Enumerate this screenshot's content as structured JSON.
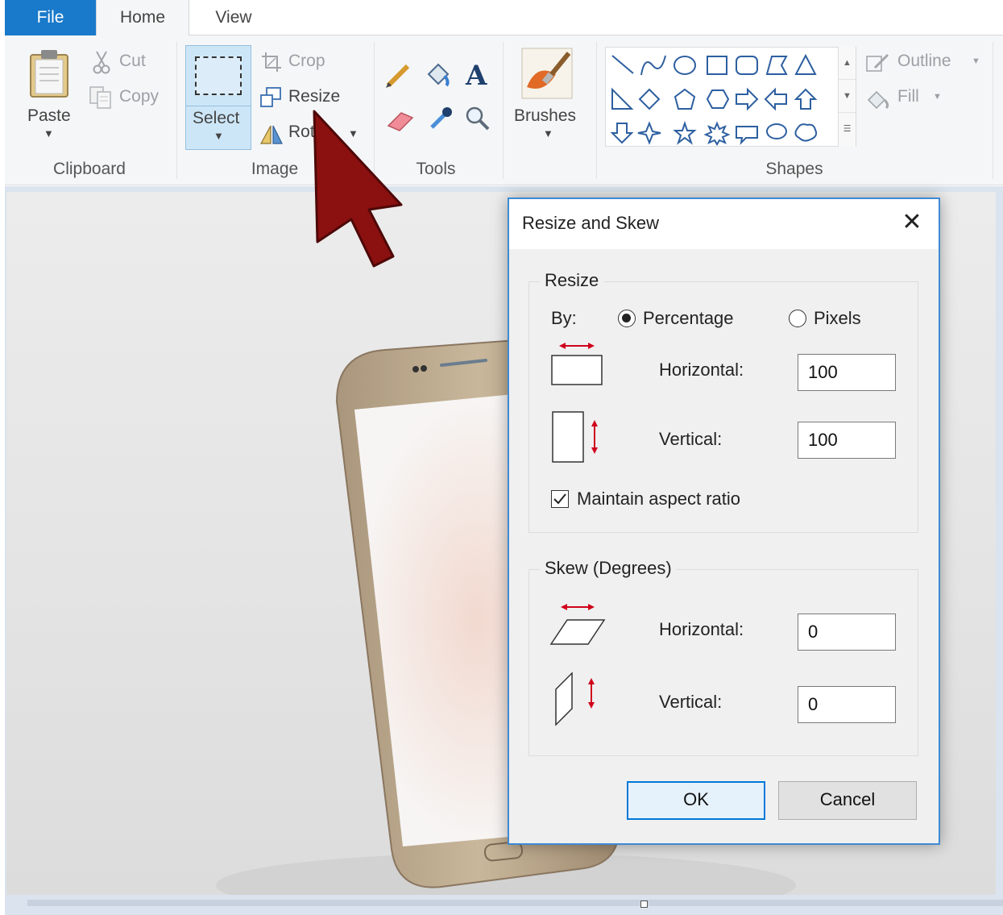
{
  "tabs": {
    "file": "File",
    "home": "Home",
    "view": "View"
  },
  "ribbon": {
    "clipboard": {
      "paste": "Paste",
      "cut": "Cut",
      "copy": "Copy",
      "label": "Clipboard"
    },
    "image": {
      "select": "Select",
      "crop": "Crop",
      "resize": "Resize",
      "rotate": "Rot",
      "label": "Image"
    },
    "tools": {
      "label": "Tools"
    },
    "brushes": {
      "label": "Brushes"
    },
    "shapes": {
      "outline": "Outline",
      "fill": "Fill",
      "label": "Shapes"
    }
  },
  "annotation": {
    "arrow_color": "#8b1010"
  },
  "dialog": {
    "title": "Resize and Skew",
    "close_glyph": "✕",
    "resize": {
      "legend": "Resize",
      "by_label": "By:",
      "percentage_label": "Percentage",
      "pixels_label": "Pixels",
      "selected_unit": "Percentage",
      "horizontal_label": "Horizontal:",
      "horizontal_value": "100",
      "vertical_label": "Vertical:",
      "vertical_value": "100",
      "maintain_label": "Maintain aspect ratio",
      "maintain_checked": true
    },
    "skew": {
      "legend": "Skew (Degrees)",
      "horizontal_label": "Horizontal:",
      "horizontal_value": "0",
      "vertical_label": "Vertical:",
      "vertical_value": "0"
    },
    "ok_label": "OK",
    "cancel_label": "Cancel"
  },
  "colors": {
    "accent": "#1979ca",
    "dialog_border": "#3f8ad4",
    "red_arrow": "#d0021b"
  }
}
